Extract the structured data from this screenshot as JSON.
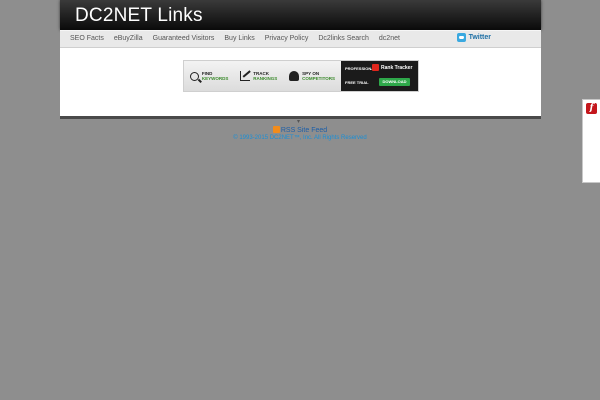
{
  "site": {
    "title": "DC2NET Links"
  },
  "nav": {
    "items": [
      "SEO Facts",
      "eBuyZilla",
      "Guaranteed Visitors",
      "Buy Links",
      "Privacy Policy",
      "Dc2links Search",
      "dc2net"
    ],
    "twitter_label": "Twitter"
  },
  "banner": {
    "find": [
      "FIND",
      "KEYWORDS"
    ],
    "track": [
      "TRACK",
      "RANKINGS"
    ],
    "spy": [
      "SPY ON",
      "COMPETITORS"
    ],
    "professional": "PROFESSIONAL",
    "product": "Rank Tracker",
    "free_trial": "FREE TRIAL",
    "download": "DOWNLOAD"
  },
  "footer": {
    "rss_label": "RSS Site Feed",
    "copyright": "© 1993-2015 DC2NET™, Inc. All Rights Reserved"
  },
  "colors": {
    "background": "#8e8e8e",
    "header": "#0a0a0a",
    "link": "#1d5fa8",
    "accent": "#1a8fd6"
  }
}
